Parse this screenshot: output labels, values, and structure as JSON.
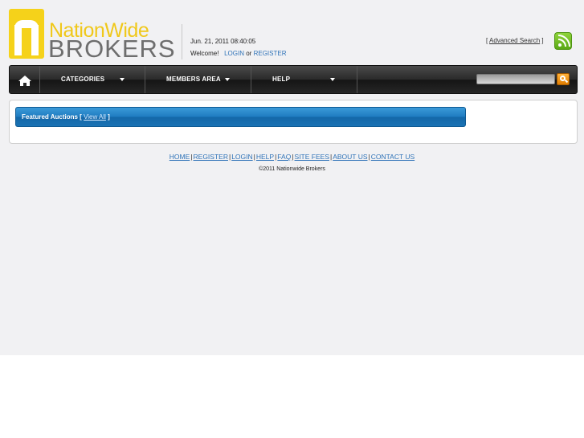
{
  "logo": {
    "line1": "NationWide",
    "line2": "BROKERS"
  },
  "header": {
    "datetime": "Jun. 21, 2011 08:40:05",
    "welcome": "Welcome!",
    "login": "LOGIN",
    "or": "or",
    "register": "REGISTER",
    "advanced_search_open": "[",
    "advanced_search": "Advanced Search",
    "advanced_search_close": "]",
    "rss_icon": "rss-feed-icon"
  },
  "nav": {
    "home_icon": "home-icon",
    "items": [
      {
        "label": "CATEGORIES"
      },
      {
        "label": "MEMBERS AREA"
      },
      {
        "label": "HELP"
      }
    ],
    "search": {
      "value": "",
      "button_icon": "search-icon"
    }
  },
  "featured": {
    "title": "Featured Auctions [",
    "view_all": "View All",
    "close": "]"
  },
  "footer": {
    "links": [
      "HOME",
      "REGISTER",
      "LOGIN",
      "HELP",
      "FAQ",
      "SITE FEES",
      "ABOUT US",
      "CONTACT US"
    ],
    "separator": "|",
    "copyright": "©2011 Nationwide Brokers"
  },
  "colors": {
    "brand_yellow": "#f5d21a",
    "brand_gray": "#6e6e6e",
    "link_blue": "#2f73b8",
    "featured_blue": "#1e7bc0",
    "nav_dark": "#262626",
    "search_orange": "#e07d00",
    "rss_green": "#5aa815"
  }
}
